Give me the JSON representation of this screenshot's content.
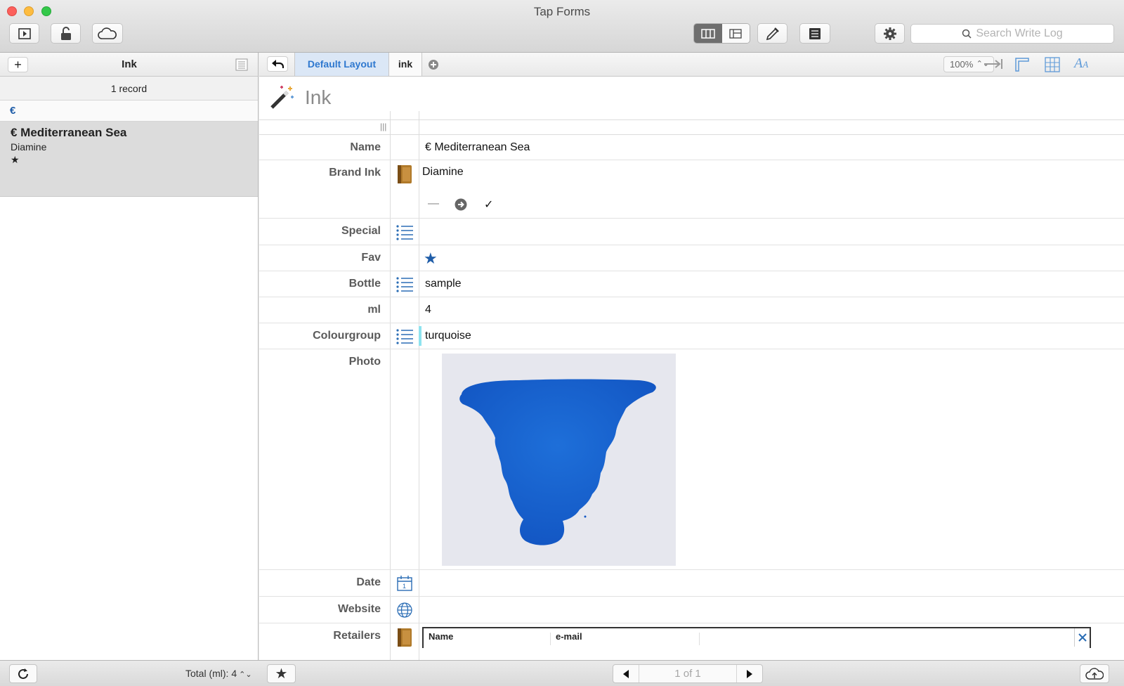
{
  "window": {
    "title": "Tap Forms"
  },
  "toolbar": {
    "search_placeholder": "Search Write Log"
  },
  "left_pane": {
    "title": "Ink",
    "record_count": "1 record",
    "group_header": "€",
    "records": [
      {
        "title": "€ Mediterranean Sea",
        "subtitle": "Diamine",
        "rating": "★"
      }
    ],
    "total": "Total (ml): 4"
  },
  "tabs": {
    "layout": "Default Layout",
    "form": "ink"
  },
  "zoom": "100%",
  "form": {
    "title": "Ink",
    "fields": {
      "name": {
        "label": "Name",
        "value": "€ Mediterranean Sea"
      },
      "brand_ink": {
        "label": "Brand Ink",
        "value": "Diamine",
        "actions": [
          "—",
          "➜",
          "✓"
        ]
      },
      "special": {
        "label": "Special",
        "value": ""
      },
      "fav": {
        "label": "Fav",
        "value": "★"
      },
      "bottle": {
        "label": "Bottle",
        "value": "sample"
      },
      "ml": {
        "label": "ml",
        "value": "4"
      },
      "colourgroup": {
        "label": "Colourgroup",
        "value": "turquoise",
        "color": "#8ee3ef"
      },
      "photo": {
        "label": "Photo"
      },
      "date": {
        "label": "Date",
        "value": ""
      },
      "website": {
        "label": "Website",
        "value": ""
      },
      "retailers": {
        "label": "Retailers",
        "columns": [
          "Name",
          "e-mail"
        ]
      }
    }
  },
  "pager": {
    "text": "1 of 1"
  },
  "colors": {
    "accent": "#2e78cf",
    "ink_blue": "#1e6fd9",
    "star": "#1f5da8"
  }
}
